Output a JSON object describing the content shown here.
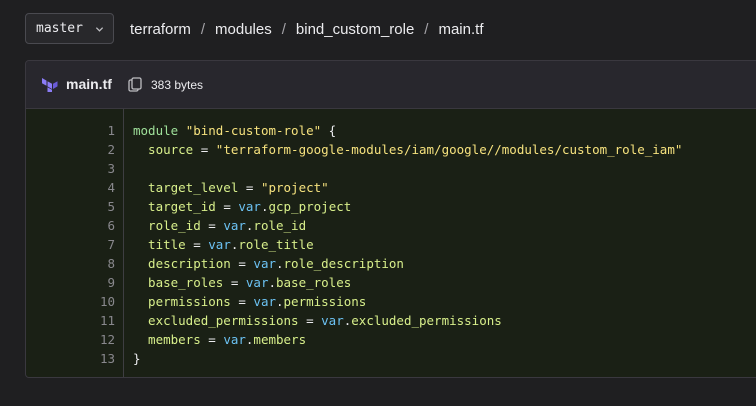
{
  "branch": {
    "label": "master"
  },
  "breadcrumb": [
    "terraform",
    "modules",
    "bind_custom_role",
    "main.tf"
  ],
  "file": {
    "name": "main.tf",
    "size": "383 bytes"
  },
  "code": {
    "lines": [
      {
        "n": "1",
        "t": [
          [
            "kw",
            "module "
          ],
          [
            "str",
            "\"bind-custom-role\""
          ],
          [
            "plain",
            " {"
          ]
        ]
      },
      {
        "n": "2",
        "t": [
          [
            "attr",
            "  source"
          ],
          [
            "plain",
            " = "
          ],
          [
            "str",
            "\"terraform-google-modules/iam/google//modules/custom_role_iam\""
          ]
        ]
      },
      {
        "n": "3",
        "t": []
      },
      {
        "n": "4",
        "t": [
          [
            "attr",
            "  target_level"
          ],
          [
            "plain",
            " = "
          ],
          [
            "str",
            "\"project\""
          ]
        ]
      },
      {
        "n": "5",
        "t": [
          [
            "attr",
            "  target_id"
          ],
          [
            "plain",
            " = "
          ],
          [
            "var",
            "var"
          ],
          [
            "plain",
            "."
          ],
          [
            "ref",
            "gcp_project"
          ]
        ]
      },
      {
        "n": "6",
        "t": [
          [
            "attr",
            "  role_id"
          ],
          [
            "plain",
            " = "
          ],
          [
            "var",
            "var"
          ],
          [
            "plain",
            "."
          ],
          [
            "ref",
            "role_id"
          ]
        ]
      },
      {
        "n": "7",
        "t": [
          [
            "attr",
            "  title"
          ],
          [
            "plain",
            " = "
          ],
          [
            "var",
            "var"
          ],
          [
            "plain",
            "."
          ],
          [
            "ref",
            "role_title"
          ]
        ]
      },
      {
        "n": "8",
        "t": [
          [
            "attr",
            "  description"
          ],
          [
            "plain",
            " = "
          ],
          [
            "var",
            "var"
          ],
          [
            "plain",
            "."
          ],
          [
            "ref",
            "role_description"
          ]
        ]
      },
      {
        "n": "9",
        "t": [
          [
            "attr",
            "  base_roles"
          ],
          [
            "plain",
            " = "
          ],
          [
            "var",
            "var"
          ],
          [
            "plain",
            "."
          ],
          [
            "ref",
            "base_roles"
          ]
        ]
      },
      {
        "n": "10",
        "t": [
          [
            "attr",
            "  permissions"
          ],
          [
            "plain",
            " = "
          ],
          [
            "var",
            "var"
          ],
          [
            "plain",
            "."
          ],
          [
            "ref",
            "permissions"
          ]
        ]
      },
      {
        "n": "11",
        "t": [
          [
            "attr",
            "  excluded_permissions"
          ],
          [
            "plain",
            " = "
          ],
          [
            "var",
            "var"
          ],
          [
            "plain",
            "."
          ],
          [
            "ref",
            "excluded_permissions"
          ]
        ]
      },
      {
        "n": "12",
        "t": [
          [
            "attr",
            "  members"
          ],
          [
            "plain",
            " = "
          ],
          [
            "var",
            "var"
          ],
          [
            "plain",
            "."
          ],
          [
            "ref",
            "members"
          ]
        ]
      },
      {
        "n": "13",
        "t": [
          [
            "plain",
            "}"
          ]
        ]
      }
    ]
  },
  "icons": {
    "branch_dropdown": "chevron-down-icon",
    "file_type": "terraform-icon",
    "copy": "copy-icon"
  },
  "colors": {
    "background": "#1f1f21",
    "code_bg": "#1a2015",
    "keyword": "#9fe09a",
    "string": "#f6e27e",
    "var": "#6cc2f3"
  }
}
